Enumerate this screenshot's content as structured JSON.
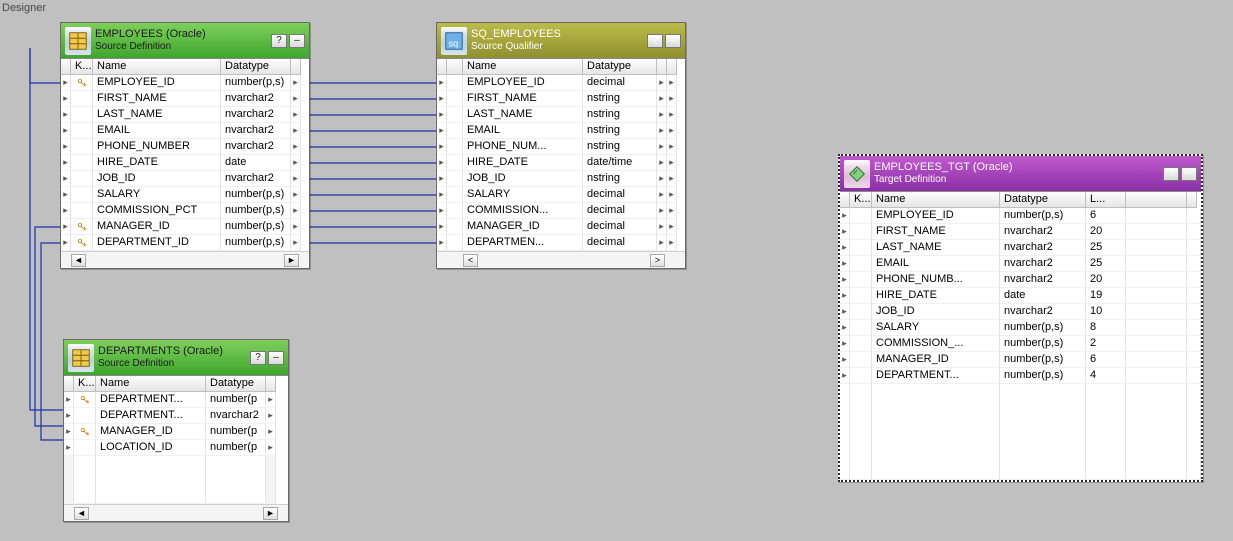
{
  "designerLabel": "Designer",
  "panes": {
    "employees": {
      "title": "EMPLOYEES (Oracle)",
      "subtitle": "Source Definition",
      "headK": "K...",
      "headName": "Name",
      "headType": "Datatype",
      "rows": [
        {
          "key": true,
          "name": "EMPLOYEE_ID",
          "type": "number(p,s)"
        },
        {
          "key": false,
          "name": "FIRST_NAME",
          "type": "nvarchar2"
        },
        {
          "key": false,
          "name": "LAST_NAME",
          "type": "nvarchar2"
        },
        {
          "key": false,
          "name": "EMAIL",
          "type": "nvarchar2"
        },
        {
          "key": false,
          "name": "PHONE_NUMBER",
          "type": "nvarchar2"
        },
        {
          "key": false,
          "name": "HIRE_DATE",
          "type": "date"
        },
        {
          "key": false,
          "name": "JOB_ID",
          "type": "nvarchar2"
        },
        {
          "key": false,
          "name": "SALARY",
          "type": "number(p,s)"
        },
        {
          "key": false,
          "name": "COMMISSION_PCT",
          "type": "number(p,s)"
        },
        {
          "key": true,
          "name": "MANAGER_ID",
          "type": "number(p,s)"
        },
        {
          "key": true,
          "name": "DEPARTMENT_ID",
          "type": "number(p,s)"
        }
      ]
    },
    "sq": {
      "title": "SQ_EMPLOYEES",
      "subtitle": "Source Qualifier",
      "headName": "Name",
      "headType": "Datatype",
      "rows": [
        {
          "name": "EMPLOYEE_ID",
          "type": "decimal"
        },
        {
          "name": "FIRST_NAME",
          "type": "nstring"
        },
        {
          "name": "LAST_NAME",
          "type": "nstring"
        },
        {
          "name": "EMAIL",
          "type": "nstring"
        },
        {
          "name": "PHONE_NUM...",
          "type": "nstring"
        },
        {
          "name": "HIRE_DATE",
          "type": "date/time"
        },
        {
          "name": "JOB_ID",
          "type": "nstring"
        },
        {
          "name": "SALARY",
          "type": "decimal"
        },
        {
          "name": "COMMISSION...",
          "type": "decimal"
        },
        {
          "name": "MANAGER_ID",
          "type": "decimal"
        },
        {
          "name": "DEPARTMEN...",
          "type": "decimal"
        }
      ]
    },
    "departments": {
      "title": "DEPARTMENTS (Oracle)",
      "subtitle": "Source Definition",
      "headK": "K...",
      "headName": "Name",
      "headType": "Datatype",
      "rows": [
        {
          "key": true,
          "name": "DEPARTMENT...",
          "type": "number(p"
        },
        {
          "key": false,
          "name": "DEPARTMENT...",
          "type": "nvarchar2"
        },
        {
          "key": true,
          "name": "MANAGER_ID",
          "type": "number(p"
        },
        {
          "key": false,
          "name": "LOCATION_ID",
          "type": "number(p"
        }
      ]
    },
    "target": {
      "title": "EMPLOYEES_TGT (Oracle)",
      "subtitle": "Target Definition",
      "headK": "K...",
      "headName": "Name",
      "headType": "Datatype",
      "headLen": "L...",
      "rows": [
        {
          "name": "EMPLOYEE_ID",
          "type": "number(p,s)",
          "len": "6"
        },
        {
          "name": "FIRST_NAME",
          "type": "nvarchar2",
          "len": "20"
        },
        {
          "name": "LAST_NAME",
          "type": "nvarchar2",
          "len": "25"
        },
        {
          "name": "EMAIL",
          "type": "nvarchar2",
          "len": "25"
        },
        {
          "name": "PHONE_NUMB...",
          "type": "nvarchar2",
          "len": "20"
        },
        {
          "name": "HIRE_DATE",
          "type": "date",
          "len": "19"
        },
        {
          "name": "JOB_ID",
          "type": "nvarchar2",
          "len": "10"
        },
        {
          "name": "SALARY",
          "type": "number(p,s)",
          "len": "8"
        },
        {
          "name": "COMMISSION_...",
          "type": "number(p,s)",
          "len": "2"
        },
        {
          "name": "MANAGER_ID",
          "type": "number(p,s)",
          "len": "6"
        },
        {
          "name": "DEPARTMENT...",
          "type": "number(p,s)",
          "len": "4"
        }
      ]
    }
  },
  "glyphs": {
    "help": "?",
    "min": "–",
    "left": "◄",
    "right": "►",
    "port": "▸"
  }
}
